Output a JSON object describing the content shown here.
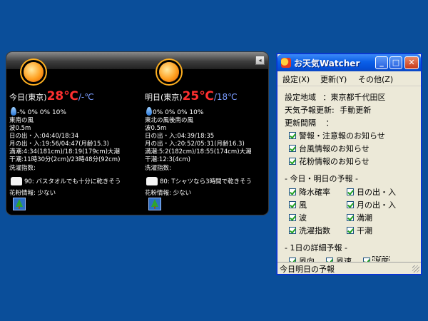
{
  "panel": {
    "today": {
      "label": "今日(東京)",
      "high": "28℃",
      "low": "/-℃",
      "rain": "-% 0% 0% 10%",
      "lines": [
        "東南の風",
        "波0.5m",
        "日の出・入:04:40/18:34",
        "月の出・入:19:56/04:47(月齢15.3)",
        "満潮:4:34(181cm)/18:19(179cm)大潮",
        "干潮:11時30分(2cm)/23時48分(92cm)",
        "洗濯指数:"
      ],
      "wash": "90: バスタオルでも十分に乾きそう",
      "pollen": "花粉情報: 少ない"
    },
    "tomorrow": {
      "label": "明日(東京)",
      "high": "25℃",
      "low": "/18℃",
      "rain": "0% 0% 0% 10%",
      "lines": [
        "東北の風後南の風",
        "波0.5m",
        "日の出・入:04:39/18:35",
        "月の出・入:20:52/05:31(月齢16.3)",
        "満潮:5:2(182cm)/18:55(174cm)大潮",
        "干潮:12:3(4cm)",
        "洗濯指数:"
      ],
      "wash": "80: Tシャツなら3時間で乾きそう",
      "pollen": "花粉情報: 少ない"
    }
  },
  "window": {
    "title": "お天気Watcher",
    "menu": [
      "設定(X)",
      "更新(Y)",
      "その他(Z)"
    ],
    "region_label": "設定地域",
    "region_value": "：東京都千代田区",
    "update_label": "天気予報更新:",
    "update_value": "手動更新",
    "interval_label": "更新間隔",
    "interval_value": "：",
    "alerts": [
      {
        "label": "警報・注意報のお知らせ",
        "checked": true
      },
      {
        "label": "台風情報のお知らせ",
        "checked": true
      },
      {
        "label": "花粉情報のお知らせ",
        "checked": true
      }
    ],
    "section_forecast": "- 今日・明日の予報 -",
    "forecast_items": [
      {
        "label": "降水確率",
        "checked": true
      },
      {
        "label": "日の出・入",
        "checked": true
      },
      {
        "label": "風",
        "checked": true
      },
      {
        "label": "月の出・入",
        "checked": true
      },
      {
        "label": "波",
        "checked": true
      },
      {
        "label": "満潮",
        "checked": true
      },
      {
        "label": "洗濯指数",
        "checked": true
      },
      {
        "label": "干潮",
        "checked": true
      }
    ],
    "section_detail": "- 1日の詳細予報 -",
    "detail_items": [
      {
        "label": "風向",
        "checked": true
      },
      {
        "label": "風速",
        "checked": true
      },
      {
        "label": "湿度",
        "checked": true
      }
    ],
    "status": "今日明日の予報"
  },
  "colors": {
    "desktop": "#0a4e9a",
    "temp_high": "#ff3030",
    "temp_low": "#7a9cff"
  }
}
